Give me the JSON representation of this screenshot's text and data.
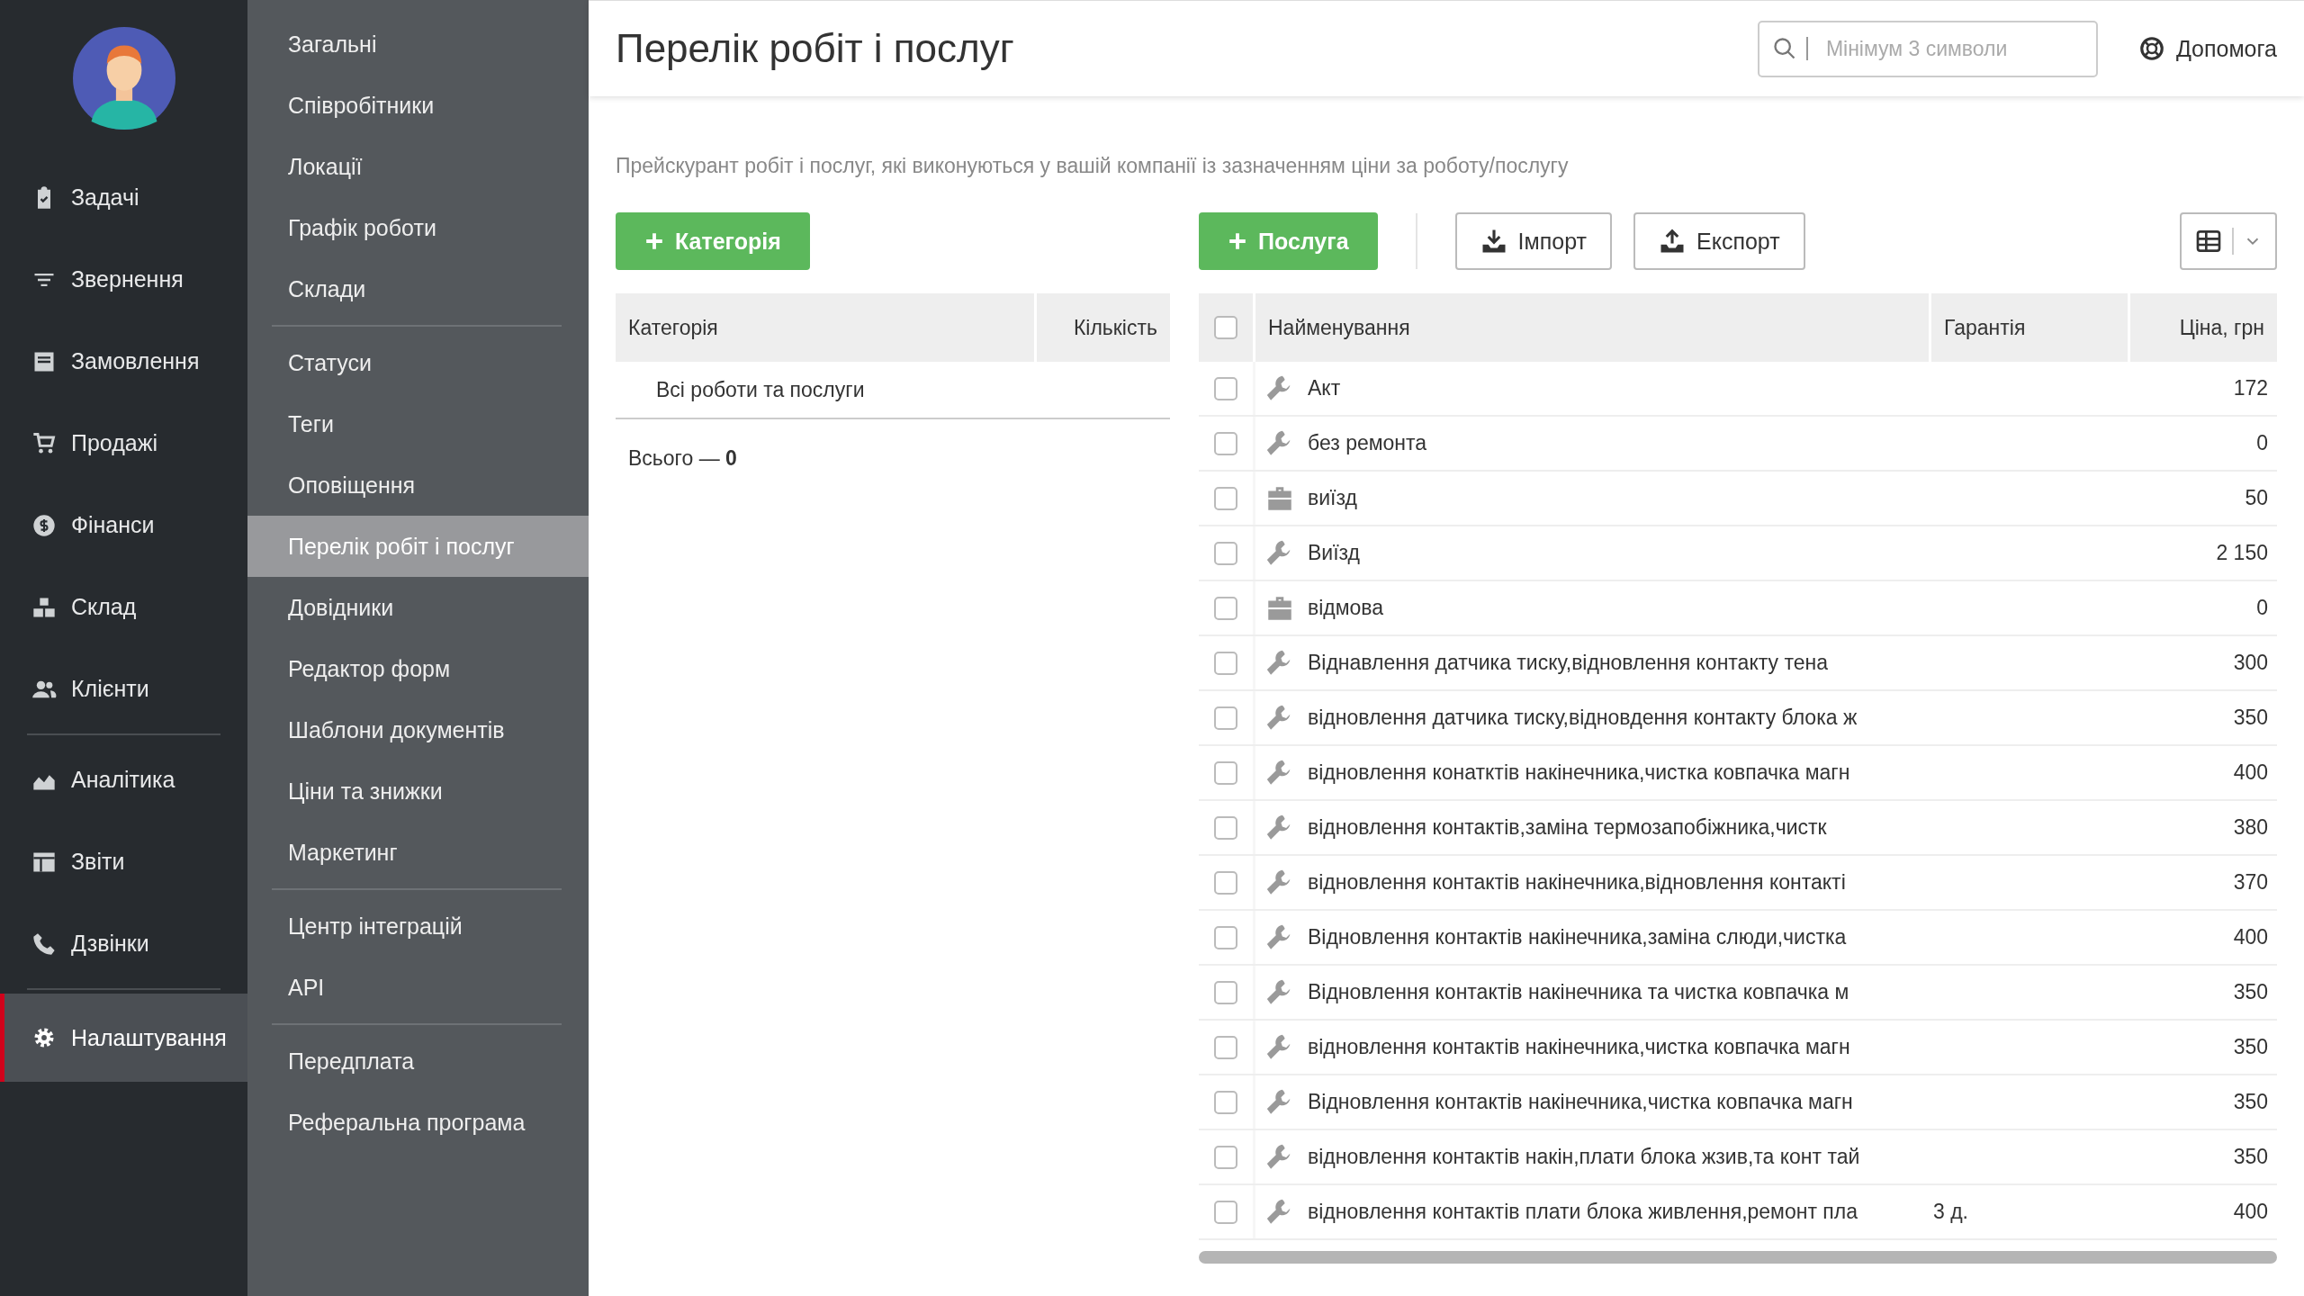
{
  "nav": {
    "items": [
      {
        "label": "Задачі",
        "selected": false
      },
      {
        "label": "Звернення",
        "selected": false
      },
      {
        "label": "Замовлення",
        "selected": false
      },
      {
        "label": "Продажі",
        "selected": false
      },
      {
        "label": "Фінанси",
        "selected": false
      },
      {
        "label": "Склад",
        "selected": false
      },
      {
        "label": "Клієнти",
        "selected": false
      },
      {
        "label": "Аналітика",
        "selected": false
      },
      {
        "label": "Звіти",
        "selected": false
      },
      {
        "label": "Дзвінки",
        "selected": false
      },
      {
        "label": "Налаштування",
        "selected": true
      }
    ]
  },
  "settings_menu": {
    "groups": [
      [
        {
          "label": "Загальні",
          "selected": false
        },
        {
          "label": "Співробітники",
          "selected": false
        },
        {
          "label": "Локації",
          "selected": false
        },
        {
          "label": "Графік роботи",
          "selected": false
        },
        {
          "label": "Склади",
          "selected": false
        }
      ],
      [
        {
          "label": "Статуси",
          "selected": false
        },
        {
          "label": "Теги",
          "selected": false
        },
        {
          "label": "Оповіщення",
          "selected": false
        },
        {
          "label": "Перелік робіт і послуг",
          "selected": true
        },
        {
          "label": "Довідники",
          "selected": false
        },
        {
          "label": "Редактор форм",
          "selected": false
        },
        {
          "label": "Шаблони документів",
          "selected": false
        },
        {
          "label": "Ціни та знижки",
          "selected": false
        },
        {
          "label": "Маркетинг",
          "selected": false
        }
      ],
      [
        {
          "label": "Центр інтеграцій",
          "selected": false
        },
        {
          "label": "API",
          "selected": false
        }
      ],
      [
        {
          "label": "Передплата",
          "selected": false
        },
        {
          "label": "Реферальна програма",
          "selected": false
        }
      ]
    ]
  },
  "header": {
    "title": "Перелік робіт і послуг",
    "search": {
      "placeholder": "Мінімум 3 символи"
    },
    "help": "Допомога"
  },
  "description": "Прейскурант робіт і послуг, які виконуються у вашій компанії із зазначенням ціни за роботу/послугу",
  "buttons": {
    "add_category": "Категорія",
    "add_service": "Послуга",
    "import": "Імпорт",
    "export": "Експорт"
  },
  "categories": {
    "columns": [
      "Категорія",
      "Кількість"
    ],
    "rows": [
      {
        "name": "Всі роботи та послуги"
      }
    ],
    "total": "Всього — **0**"
  },
  "services": {
    "columns": [
      "Найменування",
      "Гарантія",
      "Ціна, грн"
    ],
    "all_checked": false,
    "rows": [
      {
        "kind": "work",
        "name": "Акт",
        "warranty": "",
        "price": "172",
        "checked": false
      },
      {
        "kind": "work",
        "name": "без ремонта",
        "warranty": "",
        "price": "0",
        "checked": false
      },
      {
        "kind": "product",
        "name": "виїзд",
        "warranty": "",
        "price": "50",
        "checked": false
      },
      {
        "kind": "work",
        "name": "Виїзд",
        "warranty": "",
        "price": "2 150",
        "checked": false
      },
      {
        "kind": "product",
        "name": "відмова",
        "warranty": "",
        "price": "0",
        "checked": false
      },
      {
        "kind": "work",
        "name": "Віднавлення датчика тиску,відновлення контакту тена",
        "warranty": "",
        "price": "300",
        "checked": false
      },
      {
        "kind": "work",
        "name": "відновлення датчика тиску,відновдення контакту блока ж",
        "warranty": "",
        "price": "350",
        "checked": false
      },
      {
        "kind": "work",
        "name": "відновлення конатктів накінечника,чистка ковпачка магн",
        "warranty": "",
        "price": "400",
        "checked": false
      },
      {
        "kind": "work",
        "name": "відновлення контактів,заміна термозапобіжника,чистк",
        "warranty": "",
        "price": "380",
        "checked": false
      },
      {
        "kind": "work",
        "name": "відновлення контактів накінечника,відновлення контакті",
        "warranty": "",
        "price": "370",
        "checked": false
      },
      {
        "kind": "work",
        "name": "Відновлення контактів накінечника,заміна слюди,чистка",
        "warranty": "",
        "price": "400",
        "checked": false
      },
      {
        "kind": "work",
        "name": "Відновлення контактів накінечника та чистка ковпачка м",
        "warranty": "",
        "price": "350",
        "checked": false
      },
      {
        "kind": "work",
        "name": "відновлення контактів накінечника,чистка ковпачка магн",
        "warranty": "",
        "price": "350",
        "checked": false
      },
      {
        "kind": "work",
        "name": "Відновлення контактів накінечника,чистка ковпачка магн",
        "warranty": "",
        "price": "350",
        "checked": false
      },
      {
        "kind": "work",
        "name": "відновлення контактів накін,плати блока жзив,та конт тай",
        "warranty": "",
        "price": "350",
        "checked": false
      },
      {
        "kind": "work",
        "name": "відновлення контактів плати блока живлення,ремонт пла",
        "warranty": "3 д.",
        "price": "400",
        "checked": false
      }
    ]
  }
}
